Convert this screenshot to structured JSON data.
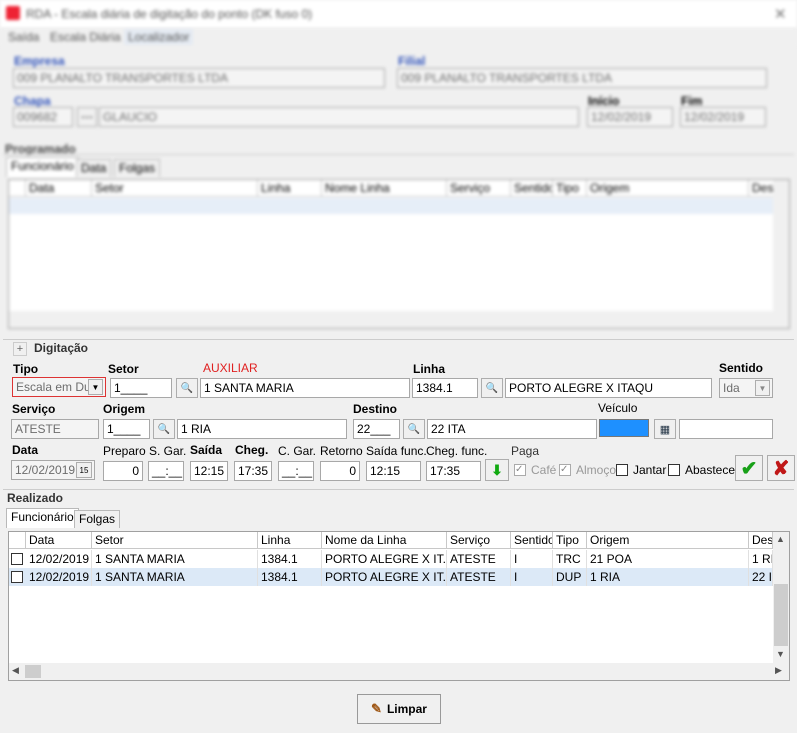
{
  "window": {
    "title": "RDA - Escala diária de digitação do ponto (DK fuso 0)"
  },
  "menu": [
    "Saída",
    "Escala Diária",
    "Localizador"
  ],
  "header": {
    "empresa_label": "Empresa",
    "empresa_value": "009 PLANALTO TRANSPORTES LTDA",
    "filial_label": "Filial",
    "filial_value": "009 PLANALTO TRANSPORTES LTDA",
    "chapa_label": "Chapa",
    "chapa_value": "009682",
    "chapa_name": "GLAUCIO",
    "inicio_label": "Início",
    "inicio_value": "12/02/2019",
    "fim_label": "Fim",
    "fim_value": "12/02/2019"
  },
  "programado": {
    "title": "Programado",
    "tabs": [
      "Funcionário",
      "Data",
      "Folgas"
    ],
    "columns": [
      "Data",
      "Setor",
      "Linha",
      "Nome Linha",
      "Serviço",
      "Sentido",
      "Tipo",
      "Origem",
      "Des"
    ]
  },
  "digitacao": {
    "title": "Digitação",
    "expander": "+",
    "tipo_label": "Tipo",
    "tipo_value": "Escala em Dup",
    "setor_label": "Setor",
    "setor_code": "1____",
    "setor_name": "1 SANTA MARIA",
    "auxiliar_label": "AUXILIAR",
    "linha_label": "Linha",
    "linha_code": "1384.1",
    "linha_name": "PORTO ALEGRE X ITAQU",
    "sentido_label": "Sentido",
    "sentido_value": "Ida",
    "servico_label": "Serviço",
    "servico_value": "ATESTE",
    "origem_label": "Origem",
    "origem_code": "1____",
    "origem_name": "1 RIA",
    "destino_label": "Destino",
    "destino_code": "22___",
    "destino_name": "22 ITA",
    "veiculo_label": "Veículo",
    "data_label": "Data",
    "data_value": "12/02/2019",
    "preparo_label": "Preparo",
    "preparo_value": "0",
    "sgar_label": "S. Gar.",
    "sgar_value": "__:__",
    "saida_label": "Saída",
    "saida_value": "12:15",
    "cheg_label": "Cheg.",
    "cheg_value": "17:35",
    "cgar_label": "C. Gar.",
    "cgar_value": "__:__",
    "retorno_label": "Retorno",
    "retorno_value": "0",
    "saida_func_label": "Saída func.",
    "saida_func_value": "12:15",
    "cheg_func_label": "Cheg. func.",
    "cheg_func_value": "17:35",
    "paga_label": "Paga",
    "cafe_label": "Café",
    "almoco_label": "Almoço",
    "jantar_label": "Jantar",
    "abastece_label": "Abastece"
  },
  "realizado": {
    "title": "Realizado",
    "tabs": [
      "Funcionário",
      "Folgas"
    ],
    "columns": [
      "Data",
      "Setor",
      "Linha",
      "Nome da Linha",
      "Serviço",
      "Sentido",
      "Tipo",
      "Origem",
      "Des"
    ],
    "rows": [
      {
        "data": "12/02/2019",
        "setor": "1 SANTA MARIA",
        "linha": "1384.1",
        "nome": "PORTO ALEGRE X IT...",
        "servico": "ATESTE",
        "sentido": "I",
        "tipo": "TRC",
        "origem": "21 POA",
        "des": "1 RI"
      },
      {
        "data": "12/02/2019",
        "setor": "1 SANTA MARIA",
        "linha": "1384.1",
        "nome": "PORTO ALEGRE X IT...",
        "servico": "ATESTE",
        "sentido": "I",
        "tipo": "DUP",
        "origem": "1 RIA",
        "des": "22 I"
      }
    ]
  },
  "footer": {
    "limpar_label": "Limpar"
  },
  "colors": {
    "veiculo_color": "#1e90ff",
    "selected_row": "#dce9f7",
    "auxiliar": "#e02020"
  }
}
